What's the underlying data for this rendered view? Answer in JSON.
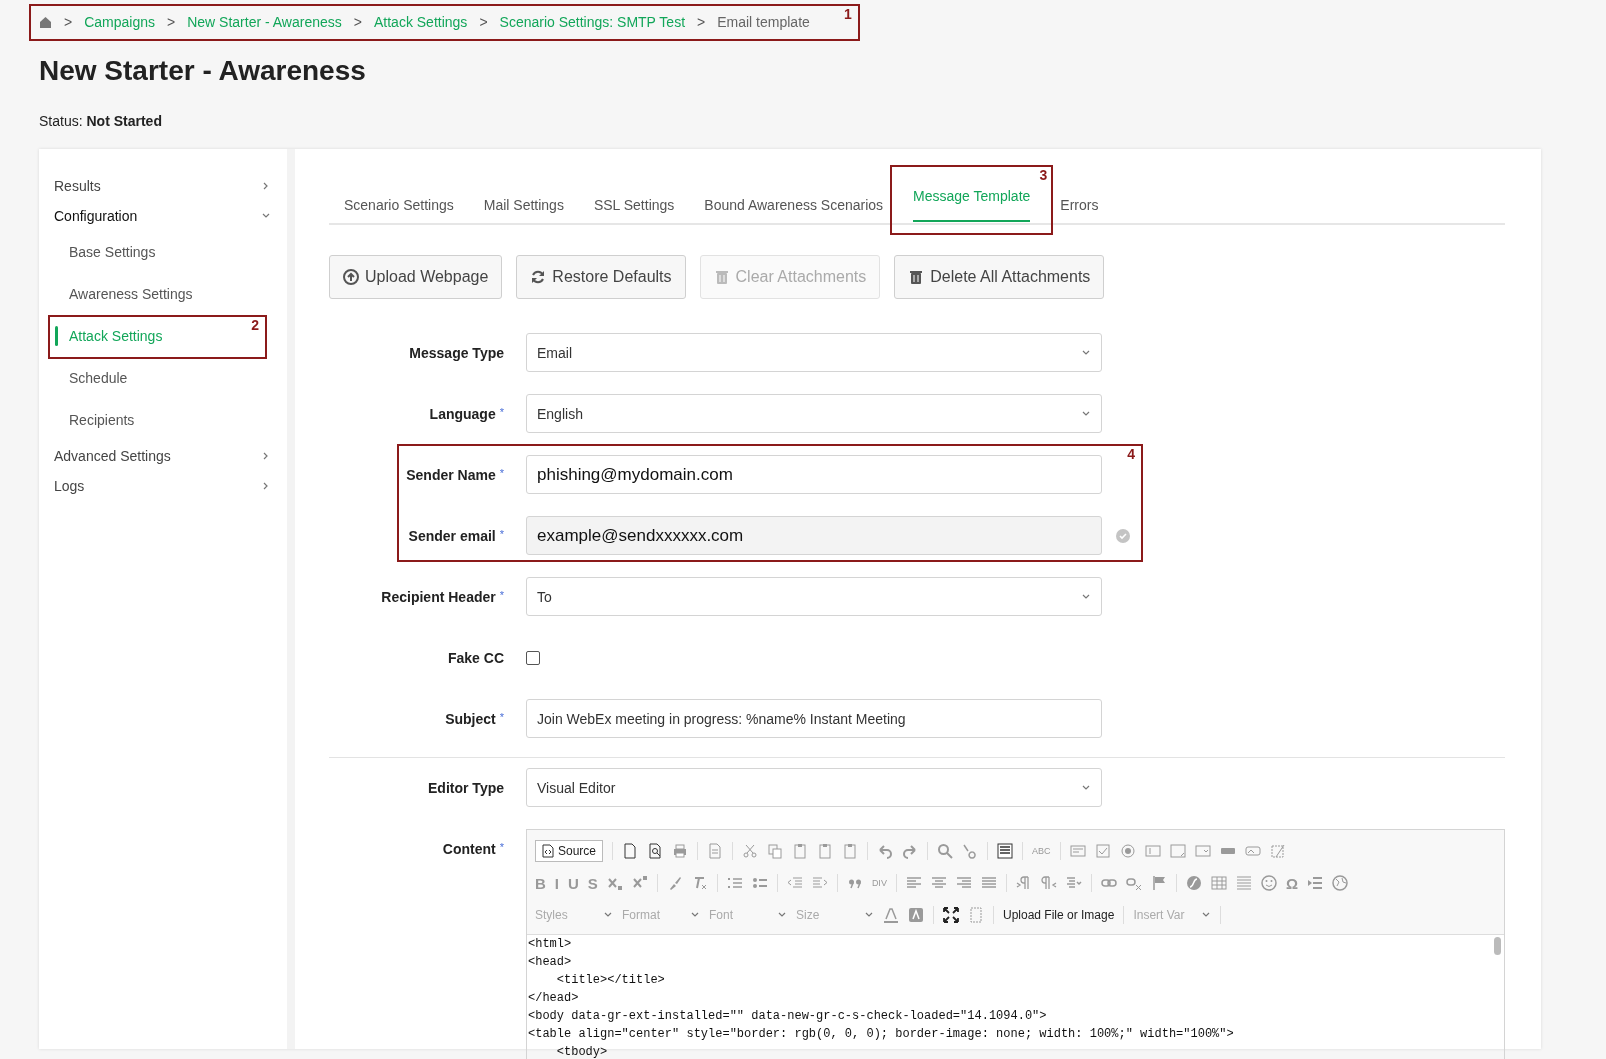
{
  "breadcrumb": {
    "callout": "1",
    "items": [
      {
        "sep": ">",
        "label": "Campaigns",
        "link": true
      },
      {
        "sep": ">",
        "label": "New Starter - Awareness",
        "link": true
      },
      {
        "sep": ">",
        "label": "Attack Settings",
        "link": true
      },
      {
        "sep": ">",
        "label": "Scenario Settings: SMTP Test",
        "link": true
      },
      {
        "sep": ">",
        "label": "Email template",
        "link": false
      }
    ]
  },
  "page": {
    "title": "New Starter - Awareness",
    "status_label": "Status:",
    "status": "Not Started"
  },
  "sidebar": {
    "items": [
      {
        "label": "Results",
        "expanded": false
      },
      {
        "label": "Configuration",
        "expanded": true,
        "children": [
          {
            "label": "Base Settings",
            "selected": false
          },
          {
            "label": "Awareness Settings",
            "selected": false
          },
          {
            "label": "Attack Settings",
            "selected": true,
            "callout": "2"
          },
          {
            "label": "Schedule",
            "selected": false
          },
          {
            "label": "Recipients",
            "selected": false
          }
        ]
      },
      {
        "label": "Advanced Settings",
        "expanded": false
      },
      {
        "label": "Logs",
        "expanded": false
      }
    ]
  },
  "tabs": [
    {
      "label": "Scenario Settings",
      "selected": false
    },
    {
      "label": "Mail Settings",
      "selected": false
    },
    {
      "label": "SSL Settings",
      "selected": false
    },
    {
      "label": "Bound Awareness Scenarios",
      "selected": false
    },
    {
      "label": "Message Template",
      "selected": true,
      "callout": "3"
    },
    {
      "label": "Errors",
      "selected": false
    }
  ],
  "buttons": [
    {
      "label": "Upload Webpage",
      "disabled": false
    },
    {
      "label": "Restore Defaults",
      "disabled": false
    },
    {
      "label": "Clear Attachments",
      "disabled": true
    },
    {
      "label": "Delete All Attachments",
      "disabled": false
    }
  ],
  "form": {
    "sender_callout": "4",
    "fields": [
      {
        "kind": "select",
        "label": "Message Type",
        "value": "Email"
      },
      {
        "kind": "select",
        "label": "Language",
        "marker": "*",
        "value": "English"
      },
      {
        "kind": "text",
        "label": "Sender Name",
        "marker": "*",
        "value": "phishing@mydomain.com"
      },
      {
        "kind": "verified",
        "label": "Sender email",
        "marker": "*",
        "value": "example@sendxxxxxx.com"
      },
      {
        "kind": "select",
        "label": "Recipient Header",
        "marker": "*",
        "value": "To"
      },
      {
        "kind": "checkbox",
        "label": "Fake CC",
        "checked": false
      },
      {
        "kind": "text",
        "label": "Subject",
        "marker": "*",
        "value": "Join WebEx meeting in progress: %name% Instant Meeting"
      },
      {
        "kind": "divider"
      },
      {
        "kind": "select",
        "label": "Editor Type",
        "value": "Visual Editor"
      }
    ]
  },
  "editor": {
    "label": "Content",
    "marker": "*",
    "source": "Source",
    "glyphs": [
      "ABC",
      "B",
      "I",
      "U",
      "S",
      "DIV",
      "Ω"
    ],
    "dropdowns": [
      "Styles",
      "Format",
      "Font",
      "Size"
    ],
    "upload": "Upload File or Image",
    "insert_var": "Insert Var",
    "code": [
      "<html>",
      "<head>",
      "    <title></title>",
      "</head>",
      "<body data-gr-ext-installed=\"\" data-new-gr-c-s-check-loaded=\"14.1094.0\">",
      "<table align=\"center\" style=\"border: rgb(0, 0, 0); border-image: none; width: 100%;\" width=\"100%\">",
      "    <tbody>"
    ]
  }
}
